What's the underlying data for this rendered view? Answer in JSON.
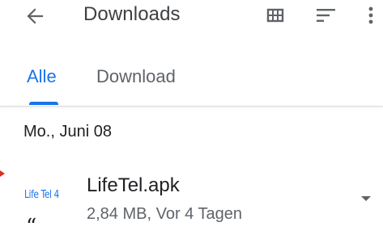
{
  "header": {
    "title": "Downloads",
    "back_icon": "arrow-back-icon",
    "grid_icon": "grid-view-icon",
    "sort_icon": "sort-icon",
    "more_icon": "more-vert-icon"
  },
  "tabs": [
    {
      "label": "Alle",
      "selected": true
    },
    {
      "label": "Download",
      "selected": false
    }
  ],
  "colors": {
    "accent": "#1a73e8",
    "secondary_text": "#5f6368",
    "edge_marker": "#d93025"
  },
  "sections": [
    {
      "date": "Mo., Juni 08",
      "items": [
        {
          "thumbnail_text": "Life Tel 4",
          "name": "LifeTel.apk",
          "meta": "2,84 MB, Vor 4 Tagen",
          "glyph": "“"
        }
      ]
    }
  ]
}
